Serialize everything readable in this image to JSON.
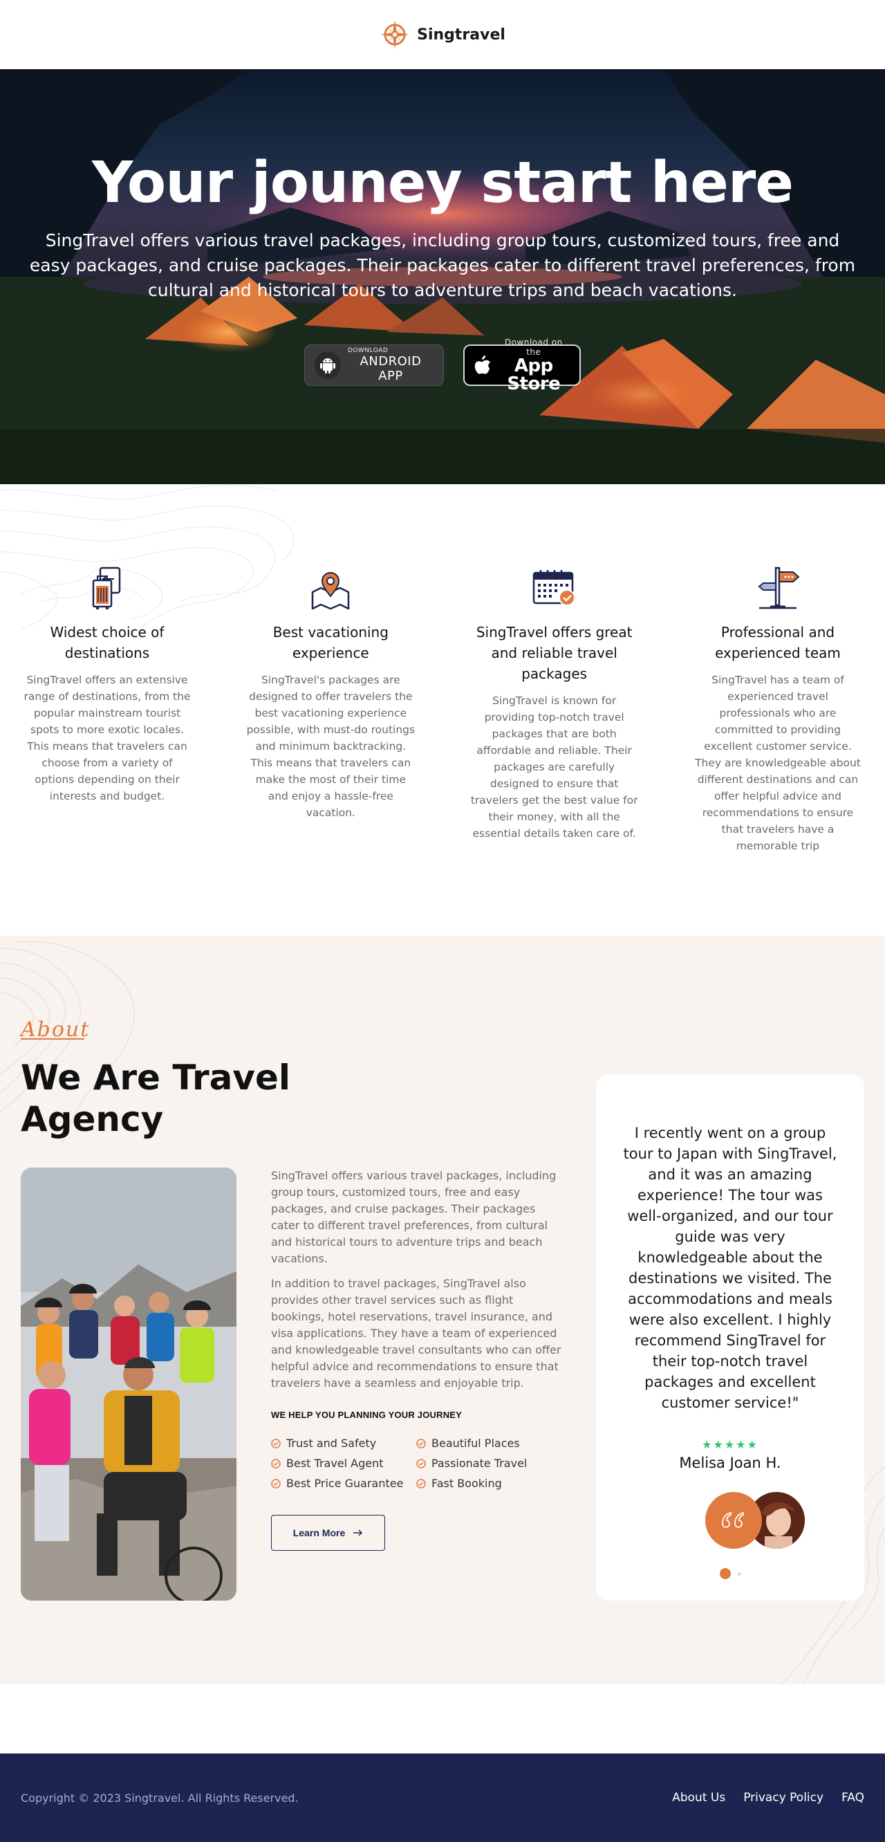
{
  "header": {
    "brand_name": "Singtravel",
    "logo_icon": "compass-icon",
    "brand_color": "#e07a3f"
  },
  "hero": {
    "title": "Your jouney start here",
    "subtitle": "SingTravel offers various travel packages, including group tours, customized tours, free and easy packages, and cruise packages. Their packages cater to different travel preferences, from cultural and historical tours to adventure trips and beach vacations.",
    "android": {
      "small": "DOWNLOAD",
      "big": "ANDROID APP",
      "icon": "android-icon"
    },
    "apple": {
      "small": "Download on the",
      "big": "App Store",
      "icon": "apple-icon"
    }
  },
  "features": [
    {
      "icon": "luggage-icon",
      "title": "Widest choice of destinations",
      "text": "SingTravel offers an extensive range of destinations, from the popular mainstream tourist spots to more exotic locales. This means that travelers can choose from a variety of options depending on their interests and budget."
    },
    {
      "icon": "map-pin-icon",
      "title": "Best vacationing experience",
      "text": "SingTravel's packages are designed to offer travelers the best vacationing experience possible, with must-do routings and minimum backtracking. This means that travelers can make the most of their time and enjoy a hassle-free vacation."
    },
    {
      "icon": "calendar-check-icon",
      "title": "SingTravel offers great and reliable travel packages",
      "text": "SingTravel is known for providing top-notch travel packages that are both affordable and reliable. Their packages are carefully designed to ensure that travelers get the best value for their money, with all the essential details taken care of."
    },
    {
      "icon": "signpost-icon",
      "title": "Professional and experienced team",
      "text": "SingTravel has a team of experienced travel professionals who are committed to providing excellent customer service. They are knowledgeable about different destinations and can offer helpful advice and recommendations to ensure that travelers have a memorable trip"
    }
  ],
  "about": {
    "kicker": "About",
    "title": "We Are Travel Agency",
    "paragraphs": [
      "SingTravel offers various travel packages, including group tours, customized tours, free and easy packages, and cruise packages. Their packages cater to different travel preferences, from cultural and historical tours to adventure trips and beach vacations.",
      "In addition to travel packages, SingTravel also provides other travel services such as flight bookings, hotel reservations, travel insurance, and visa applications. They have a team of experienced and knowledgeable travel consultants who can offer helpful advice and recommendations to ensure that travelers have a seamless and enjoyable trip."
    ],
    "help_title": "WE HELP YOU PLANNING YOUR JOURNEY",
    "checks": [
      "Trust and Safety",
      "Beautiful Places",
      "Best Travel Agent",
      "Passionate Travel",
      "Best Price Guarantee",
      "Fast Booking"
    ],
    "learn_more": "Learn More"
  },
  "testimonial": {
    "quote": "I recently went on a group tour to Japan with SingTravel, and it was an amazing experience! The tour was well-organized, and our tour guide was very knowledgeable about the destinations we visited. The accommodations and meals were also excellent. I highly recommend SingTravel for their top-notch travel packages and excellent customer service!\"",
    "stars": "★★★★★",
    "rating": 5,
    "name": "Melisa Joan H.",
    "star_color": "#2ec56b"
  },
  "footer": {
    "copyright": "Copyright © 2023 Singtravel. All Rights Reserved.",
    "links": [
      "About Us",
      "Privacy Policy",
      "FAQ"
    ],
    "background": "#1c2550"
  }
}
